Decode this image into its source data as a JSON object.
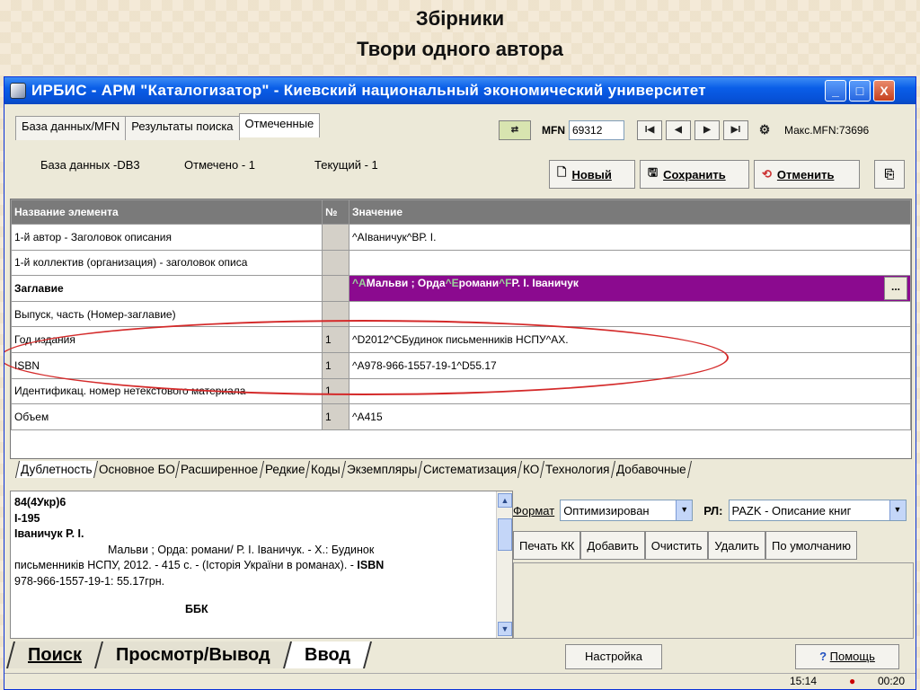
{
  "slide": {
    "title1": "Збірники",
    "title2": "Твори одного автора"
  },
  "window": {
    "title": "ИРБИС - АРМ \"Каталогизатор\" - Киевский национальный экономический университет",
    "min": "_",
    "max": "□",
    "close": "X"
  },
  "top_tabs": [
    "База данных/MFN",
    "Результаты поиска",
    "Отмеченные"
  ],
  "status": {
    "db": "База данных -DB3",
    "marked": "Отмечено - 1",
    "current": "Текущий -  1"
  },
  "toolbar": {
    "mfn_label": "MFN",
    "mfn_value": "69312",
    "max_mfn": "Макс.MFN:73696",
    "first": "I◀",
    "prev": "◀",
    "next": "▶",
    "last": "▶I"
  },
  "buttons": {
    "new": "Новый",
    "save": "Сохранить",
    "cancel": "Отменить"
  },
  "grid": {
    "headers": [
      "Название элемента",
      "№",
      "Значение"
    ],
    "rows": [
      {
        "name": "1-й автор - Заголовок описания",
        "num": "",
        "value": "^AІваничук^BР. І."
      },
      {
        "name": "1-й коллектив (организация) - заголовок описа",
        "num": "",
        "value": ""
      },
      {
        "name": "Заглавие",
        "num": "",
        "value": ""
      },
      {
        "name": "Выпуск, часть (Номер-заглавие)",
        "num": "",
        "value": ""
      },
      {
        "name": "Год издания",
        "num": "1",
        "value": "^D2012^CБудинок  письменників НСПУ^AХ."
      },
      {
        "name": "ISBN",
        "num": "1",
        "value": "^A978-966-1557-19-1^D55.17"
      },
      {
        "name": "Идентификац. номер нетекстового материала",
        "num": "1",
        "value": ""
      },
      {
        "name": "Объем",
        "num": "1",
        "value": "^A415"
      }
    ],
    "highlight": {
      "p1": "^",
      "p2": "A",
      "p3": "Мальви ; Орда",
      "p4": "^",
      "p5": "E",
      "p6": "романи",
      "p7": "^",
      "p8": "F",
      "p9": "Р. І. Іваничук",
      "dots": "..."
    }
  },
  "bottom_tabs": [
    "Дублетность",
    "Основное БО",
    "Расширенное",
    "Редкие",
    "Коды",
    "Экземпляры",
    "Систематизация",
    "КО",
    "Технология",
    "Добавочные"
  ],
  "preview": {
    "l1": "84(4Укр)6",
    "l2": "І-195",
    "l3": "Іваничук Р. І.",
    "l4": "Мальви ; Орда: романи/ Р. І. Іваничук. - Х.: Будинок",
    "l5a": "письменників НСПУ, 2012. - 415 с. - (Історія України в романах). - ",
    "l5b": "ISBN",
    "l6": "978-966-1557-19-1: 55.17грн.",
    "l7": "ББК"
  },
  "format": {
    "label": "Формат",
    "value": "Оптимизирован",
    "rl_label": "РЛ:",
    "rl_value": "PAZK - Описание книг"
  },
  "actions": [
    "Печать КК",
    "Добавить",
    "Очистить",
    "Удалить",
    "По умолчанию"
  ],
  "nav_tabs": [
    "Поиск",
    "Просмотр/Вывод",
    "Ввод"
  ],
  "settings": "Настройка",
  "help": "Помощь",
  "statusbar": {
    "time": "15:14",
    "elapsed": "00:20"
  },
  "colors": {
    "highlight_row": "#8b0a8f",
    "oval": "#d42a2a",
    "title_blue": "#0a5ee8"
  }
}
